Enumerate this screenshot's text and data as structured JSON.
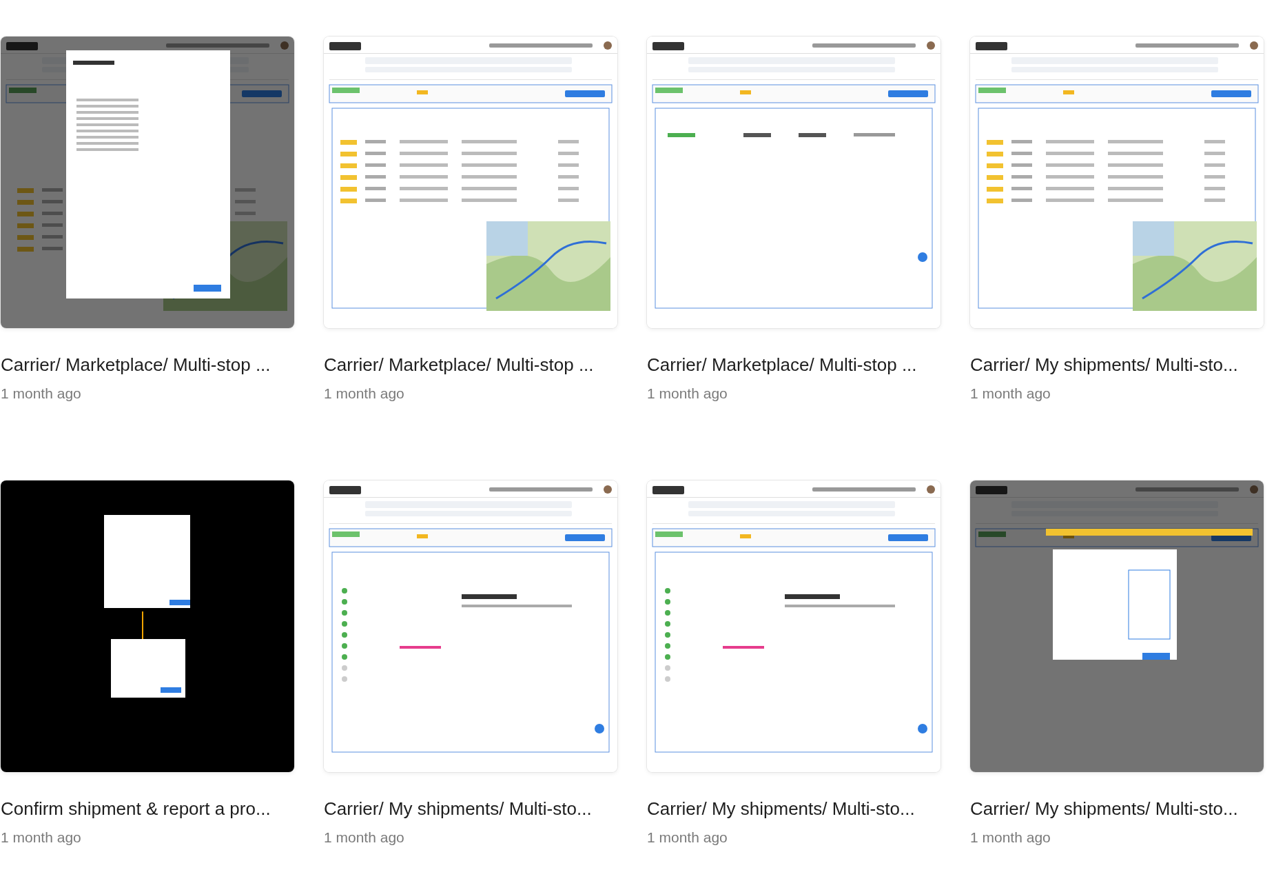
{
  "files": [
    {
      "title": "Carrier/ Marketplace/ Multi-stop ...",
      "time": "1 month ago",
      "kind": "overlay-modal"
    },
    {
      "title": "Carrier/ Marketplace/ Multi-stop ...",
      "time": "1 month ago",
      "kind": "map"
    },
    {
      "title": "Carrier/ Marketplace/ Multi-stop ...",
      "time": "1 month ago",
      "kind": "details"
    },
    {
      "title": "Carrier/ My shipments/ Multi-sto...",
      "time": "1 month ago",
      "kind": "map"
    },
    {
      "title": "Confirm shipment & report a pro...",
      "time": "1 month ago",
      "kind": "dark-dialogs"
    },
    {
      "title": "Carrier/ My shipments/ Multi-sto...",
      "time": "1 month ago",
      "kind": "status"
    },
    {
      "title": "Carrier/ My shipments/ Multi-sto...",
      "time": "1 month ago",
      "kind": "status"
    },
    {
      "title": "Carrier/ My shipments/ Multi-sto...",
      "time": "1 month ago",
      "kind": "overlay-dropdown"
    }
  ]
}
